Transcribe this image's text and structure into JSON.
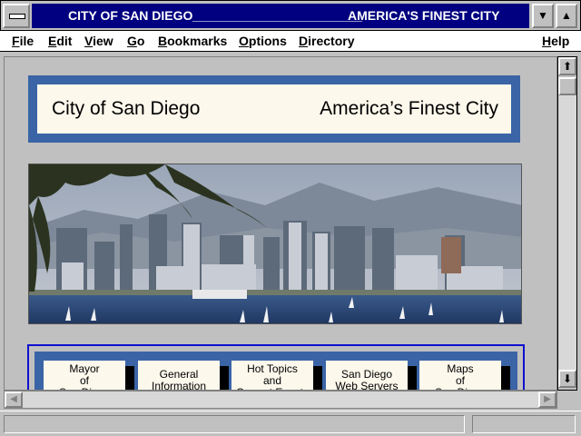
{
  "window": {
    "title_part1": "CITY OF SAN DIEGO",
    "title_part2": "________________________",
    "title_part3": "AMERICA'S FINEST CITY",
    "minimize_glyph": "▼",
    "maximize_glyph": "▲"
  },
  "menu": {
    "items": [
      {
        "label": "File"
      },
      {
        "label": "Edit"
      },
      {
        "label": "View"
      },
      {
        "label": "Go"
      },
      {
        "label": "Bookmarks"
      },
      {
        "label": "Options"
      },
      {
        "label": "Directory"
      },
      {
        "label": "Help"
      }
    ]
  },
  "banner": {
    "left": "City of San Diego",
    "right": "America’s Finest City"
  },
  "nav": {
    "buttons": [
      {
        "label": "Mayor\nof\nSan Diego"
      },
      {
        "label": "General\nInformation"
      },
      {
        "label": "Hot Topics\nand\nCurrent Events"
      },
      {
        "label": "San Diego\nWeb Servers"
      },
      {
        "label": "Maps\nof\nSan Diego"
      }
    ]
  },
  "scrollbars": {
    "up_glyph": "⬆",
    "down_glyph": "⬇",
    "left_glyph": "◀",
    "right_glyph": "▶"
  },
  "colors": {
    "titlebar": "#000080",
    "banner_frame": "#3a64a6",
    "banner_fill": "#fdf8ec",
    "nav_border": "#1010d0"
  },
  "status": {
    "text": ""
  }
}
